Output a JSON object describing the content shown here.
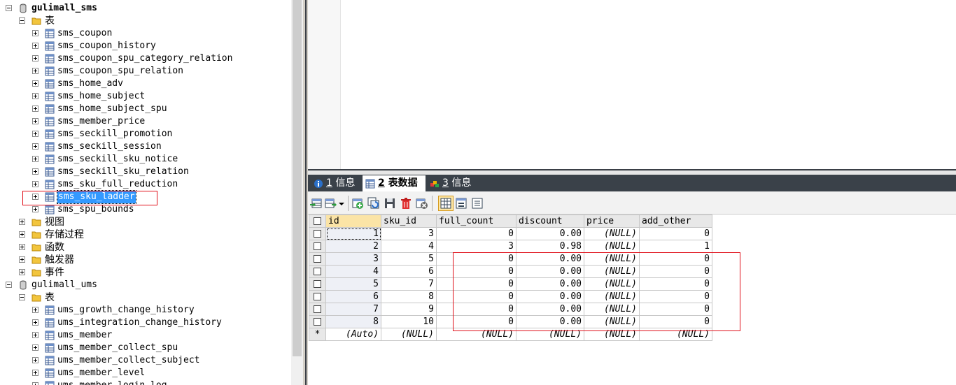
{
  "tree": {
    "db1": "gulimall_sms",
    "db1_tables_folder": "表",
    "db1_tables": [
      "sms_coupon",
      "sms_coupon_history",
      "sms_coupon_spu_category_relation",
      "sms_coupon_spu_relation",
      "sms_home_adv",
      "sms_home_subject",
      "sms_home_subject_spu",
      "sms_member_price",
      "sms_seckill_promotion",
      "sms_seckill_session",
      "sms_seckill_sku_notice",
      "sms_seckill_sku_relation",
      "sms_sku_full_reduction",
      "sms_sku_ladder",
      "sms_spu_bounds"
    ],
    "db1_folders": [
      "视图",
      "存储过程",
      "函数",
      "触发器",
      "事件"
    ],
    "db2": "gulimall_ums",
    "db2_tables_folder": "表",
    "db2_tables": [
      "ums_growth_change_history",
      "ums_integration_change_history",
      "ums_member",
      "ums_member_collect_spu",
      "ums_member_collect_subject",
      "ums_member_level",
      "ums_member_login_log"
    ]
  },
  "tabs": [
    {
      "num": "1",
      "label": " 信息"
    },
    {
      "num": "2",
      "label": " 表数据"
    },
    {
      "num": "3",
      "label": " 信息"
    }
  ],
  "grid": {
    "columns": [
      "id",
      "sku_id",
      "full_count",
      "discount",
      "price",
      "add_other"
    ],
    "rows": [
      [
        "1",
        "3",
        "0",
        "0.00",
        "(NULL)",
        "0"
      ],
      [
        "2",
        "4",
        "3",
        "0.98",
        "(NULL)",
        "1"
      ],
      [
        "3",
        "5",
        "0",
        "0.00",
        "(NULL)",
        "0"
      ],
      [
        "4",
        "6",
        "0",
        "0.00",
        "(NULL)",
        "0"
      ],
      [
        "5",
        "7",
        "0",
        "0.00",
        "(NULL)",
        "0"
      ],
      [
        "6",
        "8",
        "0",
        "0.00",
        "(NULL)",
        "0"
      ],
      [
        "7",
        "9",
        "0",
        "0.00",
        "(NULL)",
        "0"
      ],
      [
        "8",
        "10",
        "0",
        "0.00",
        "(NULL)",
        "0"
      ]
    ],
    "new_row_marker": "*",
    "new_row": [
      "(Auto)",
      "(NULL)",
      "(NULL)",
      "(NULL)",
      "(NULL)",
      "(NULL)"
    ]
  },
  "colors": {
    "highlight_box": "#e0101a",
    "selection": "#3399ff",
    "tabbar": "#3a4149"
  }
}
